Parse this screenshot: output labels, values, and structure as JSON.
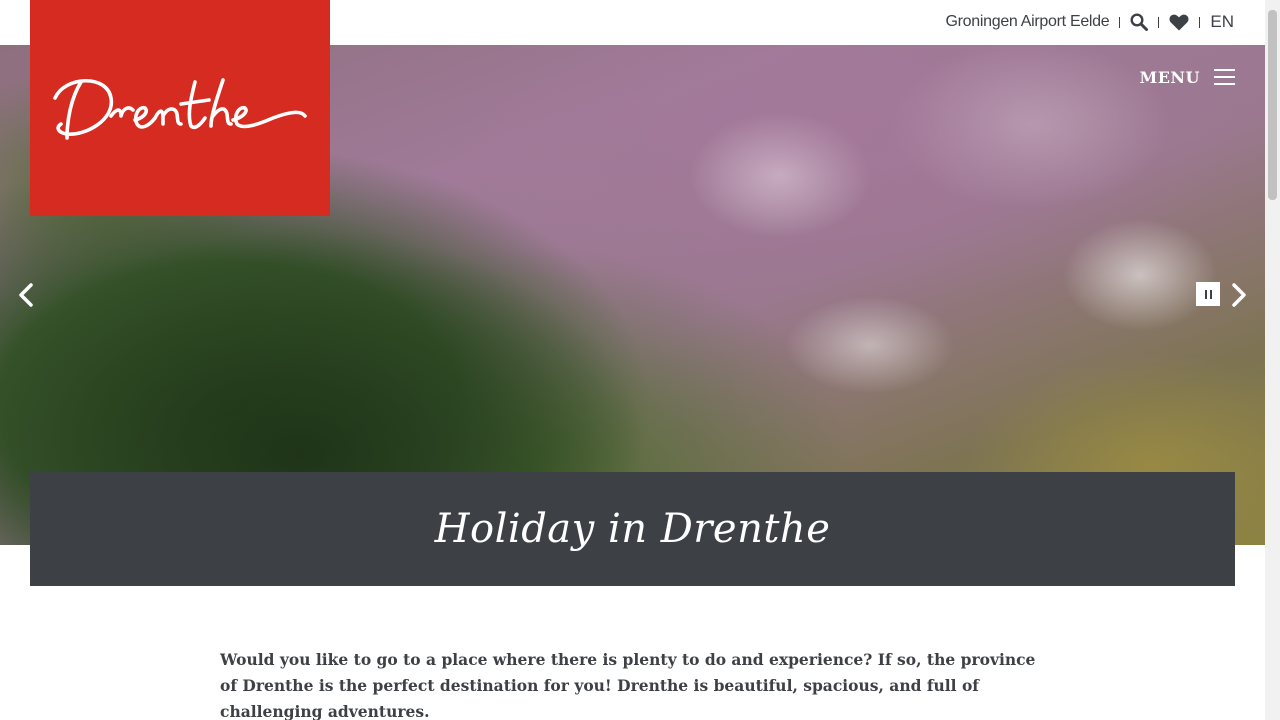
{
  "brand": {
    "logo_text": "Drenthe",
    "logo_color": "#d62b20"
  },
  "topbar": {
    "airport_link": "Groningen Airport Eelde",
    "search_icon": "search-icon",
    "favorites_icon": "heart-icon",
    "language": "EN"
  },
  "hero": {
    "menu_label": "MENU",
    "prev_icon": "chevron-left-icon",
    "next_icon": "chevron-right-icon",
    "pause_icon": "pause-icon"
  },
  "main": {
    "title": "Holiday in Drenthe",
    "intro": "Would you like to go to a place where there is plenty to do and experience? If so, the province of Drenthe is the perfect destination for you! Drenthe is beautiful, spacious, and full of challenging adventures."
  },
  "colors": {
    "dark_band": "#3d4145",
    "text": "#3d4145",
    "accent_red": "#d62b20"
  }
}
